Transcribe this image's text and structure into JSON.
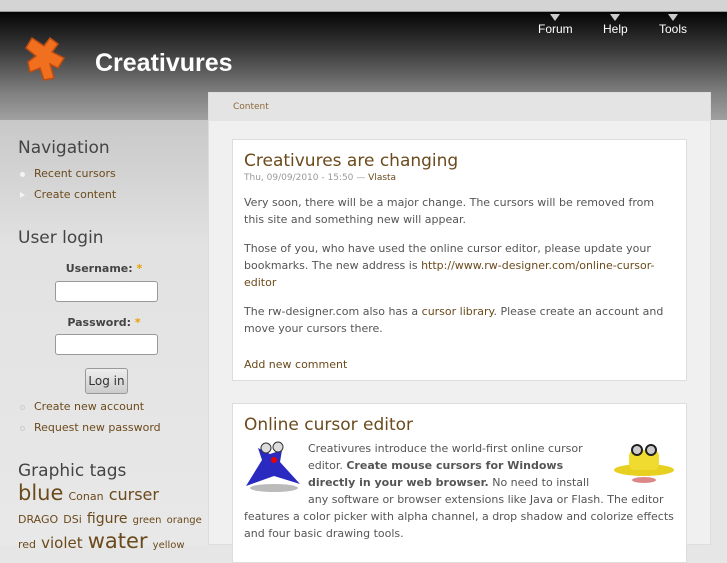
{
  "site": {
    "name": "Creativures"
  },
  "topnav": [
    "Forum",
    "Help",
    "Tools"
  ],
  "breadcrumb": "Content",
  "navigation": {
    "title": "Navigation",
    "items": [
      "Recent cursors",
      "Create content"
    ]
  },
  "login": {
    "title": "User login",
    "username_label": "Username:",
    "password_label": "Password:",
    "required": "*",
    "username_value": "",
    "password_value": "",
    "button": "Log in",
    "links": [
      "Create new account",
      "Request new password"
    ]
  },
  "tags": {
    "title": "Graphic tags",
    "items": [
      "blue",
      "Conan",
      "curser",
      "DRAGO",
      "DSi",
      "figure",
      "green",
      "orange",
      "red",
      "violet",
      "water",
      "yellow"
    ]
  },
  "posts": [
    {
      "title": "Creativures are changing",
      "date": "Thu, 09/09/2010 - 15:50 —",
      "author": "Vlasta",
      "p1": "Very soon, there will be a major change. The cursors will be removed from this site and something new will appear.",
      "p2": "Those of you, who have used the online cursor editor, please update your bookmarks. The new address is ",
      "p2_link": "http://www.rw-designer.com/online-cursor-editor",
      "p3a": "The rw-designer.com also has a ",
      "p3_link": "cursor library",
      "p3b": ". Please create an account and move your cursors there.",
      "comment": "Add new comment"
    },
    {
      "title": "Online cursor editor",
      "intro": "Creativures introduce the world-first online cursor editor. ",
      "bold": "Create mouse cursors for Windows directly in your web browser.",
      "rest": " No need to install any software or browser extensions like Java or Flash. The editor features a color picker with alpha channel, a drop shadow and colorize effects and four basic drawing tools."
    }
  ]
}
